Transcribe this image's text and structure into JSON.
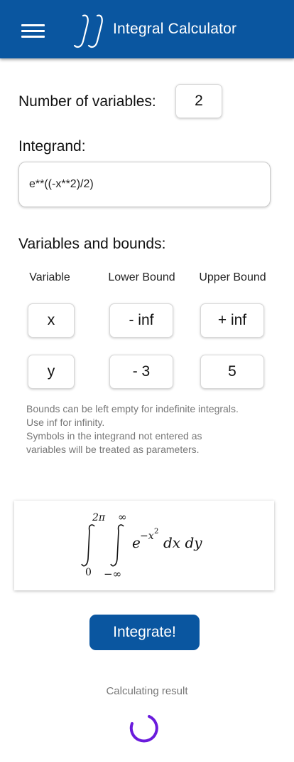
{
  "header": {
    "title": "Integral Calculator",
    "logo_icon": "double-integral-logo-icon",
    "menu_icon": "hamburger-menu-icon",
    "bar_color": "#0a56a0"
  },
  "form": {
    "num_variables_label": "Number of variables:",
    "num_variables_value": "2",
    "integrand_label": "Integrand:",
    "integrand_value": "e**((-x**2)/2)",
    "variables_label": "Variables and bounds:",
    "columns": {
      "variable": "Variable",
      "lower": "Lower Bound",
      "upper": "Upper Bound"
    },
    "rows": [
      {
        "variable": "x",
        "lower": "- inf",
        "upper": "+ inf"
      },
      {
        "variable": "y",
        "lower": "- 3",
        "upper": "5"
      }
    ],
    "hint_lines": [
      "Bounds can be left empty for indefinite integrals.",
      "Use inf for infinity.",
      "Symbols in the integrand not entered as",
      "variables will be treated as parameters."
    ]
  },
  "preview": {
    "outer_upper": "2π",
    "outer_lower": "0",
    "inner_upper": "∞",
    "inner_lower": "−∞",
    "base": "e",
    "exponent": "−x",
    "exponent_power": "2",
    "differentials": "dx dy"
  },
  "actions": {
    "integrate_label": "Integrate!",
    "button_color": "#0a56a0"
  },
  "status": {
    "text": "Calculating result",
    "spinner_color": "#6a1bdc"
  }
}
